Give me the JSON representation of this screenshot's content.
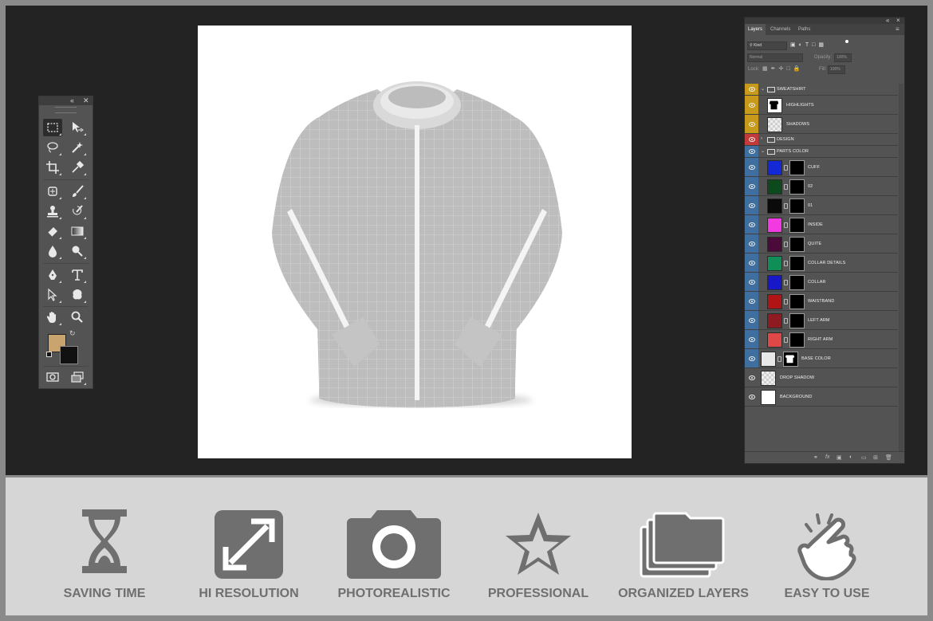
{
  "layers_panel": {
    "tabs": [
      "Layers",
      "Channels",
      "Paths"
    ],
    "filter_kind": "Kind",
    "blend_mode": "Normal",
    "opacity_label": "Opacity:",
    "opacity_value": "100%",
    "lock_label": "Lock:",
    "fill_label": "Fill:",
    "fill_value": "100%",
    "layers": [
      {
        "name": "SWEATSHIRT",
        "type": "group",
        "label_color": "#c79a1b",
        "thumb": ""
      },
      {
        "name": "HIGHLIGHTS",
        "type": "layer",
        "label_color": "#c79a1b",
        "thumb": "#ffffff"
      },
      {
        "name": "SHADOWS",
        "type": "layer",
        "label_color": "#c79a1b",
        "thumb": "checker"
      },
      {
        "name": "DESIGN",
        "type": "group",
        "label_color": "#c23a3a",
        "thumb": ""
      },
      {
        "name": "PARTS COLOR",
        "type": "group",
        "label_color": "#3f6f9f",
        "thumb": ""
      },
      {
        "name": "CUFF",
        "type": "layer",
        "label_color": "#3f6f9f",
        "thumb": "#1428d8"
      },
      {
        "name": "02",
        "type": "layer",
        "label_color": "#3f6f9f",
        "thumb": "#0c4a1e"
      },
      {
        "name": "01",
        "type": "layer",
        "label_color": "#3f6f9f",
        "thumb": "#0a0a0a"
      },
      {
        "name": "INSIDE",
        "type": "layer",
        "label_color": "#3f6f9f",
        "thumb": "#f23ae0"
      },
      {
        "name": "QUITE",
        "type": "layer",
        "label_color": "#3f6f9f",
        "thumb": "#4a0a3a"
      },
      {
        "name": "COLLAR DETAILS",
        "type": "layer",
        "label_color": "#3f6f9f",
        "thumb": "#0f8e58"
      },
      {
        "name": "COLLAR",
        "type": "layer",
        "label_color": "#3f6f9f",
        "thumb": "#1818c8"
      },
      {
        "name": "WAISTBAND",
        "type": "layer",
        "label_color": "#3f6f9f",
        "thumb": "#b01414"
      },
      {
        "name": "LEFT ARM",
        "type": "layer",
        "label_color": "#3f6f9f",
        "thumb": "#8e1a22"
      },
      {
        "name": "RIGHT ARM",
        "type": "layer",
        "label_color": "#3f6f9f",
        "thumb": "#e04848"
      },
      {
        "name": "BASE COLOR",
        "type": "layer",
        "label_color": "#3f6f9f",
        "thumb": "#e8e8e8"
      },
      {
        "name": "DROP SHADOW",
        "type": "layer",
        "label_color": "",
        "thumb": "checker"
      },
      {
        "name": "BACKGROUND",
        "type": "layer",
        "label_color": "",
        "thumb": "#ffffff"
      }
    ]
  },
  "toolbox": {
    "foreground_color": "#c9a46f",
    "background_color": "#111111"
  },
  "features": [
    {
      "label": "SAVING TIME",
      "icon": "hourglass-icon"
    },
    {
      "label": "HI RESOLUTION",
      "icon": "expand-arrows-icon"
    },
    {
      "label": "PHOTOREALISTIC",
      "icon": "camera-icon"
    },
    {
      "label": "PROFESSIONAL",
      "icon": "star-icon"
    },
    {
      "label": "ORGANIZED LAYERS",
      "icon": "folders-icon"
    },
    {
      "label": "EASY TO USE",
      "icon": "pointing-hand-icon"
    }
  ]
}
